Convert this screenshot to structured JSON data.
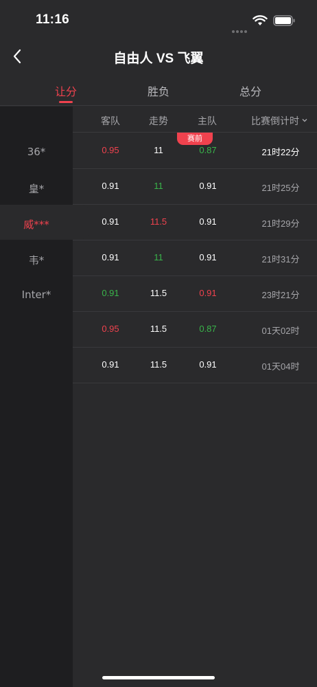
{
  "status_bar": {
    "time": "11:16"
  },
  "nav": {
    "title": "自由人 VS 飞翼"
  },
  "tabs": [
    {
      "label": "让分",
      "active": true
    },
    {
      "label": "胜负",
      "active": false
    },
    {
      "label": "总分",
      "active": false
    }
  ],
  "table": {
    "headers": {
      "away": "客队",
      "trend": "走势",
      "home": "主队",
      "countdown": "比赛倒计时"
    },
    "prematch_badge": "赛前",
    "companies": [
      {
        "name": "36*",
        "active": false
      },
      {
        "name": "皇*",
        "active": false
      },
      {
        "name": "威***",
        "active": true
      },
      {
        "name": "韦*",
        "active": false
      },
      {
        "name": "Inter*",
        "active": false
      }
    ],
    "rows": [
      {
        "away": "0.95",
        "away_color": "red",
        "trend": "11",
        "trend_color": "white",
        "home": "0.87",
        "home_color": "green",
        "countdown": "21时22分",
        "countdown_bright": true
      },
      {
        "away": "0.91",
        "away_color": "white",
        "trend": "11",
        "trend_color": "green",
        "home": "0.91",
        "home_color": "white",
        "countdown": "21时25分",
        "countdown_bright": false
      },
      {
        "away": "0.91",
        "away_color": "white",
        "trend": "11.5",
        "trend_color": "red",
        "home": "0.91",
        "home_color": "white",
        "countdown": "21时29分",
        "countdown_bright": false
      },
      {
        "away": "0.91",
        "away_color": "white",
        "trend": "11",
        "trend_color": "green",
        "home": "0.91",
        "home_color": "white",
        "countdown": "21时31分",
        "countdown_bright": false
      },
      {
        "away": "0.91",
        "away_color": "green",
        "trend": "11.5",
        "trend_color": "white",
        "home": "0.91",
        "home_color": "red",
        "countdown": "23时21分",
        "countdown_bright": false
      },
      {
        "away": "0.95",
        "away_color": "red",
        "trend": "11.5",
        "trend_color": "white",
        "home": "0.87",
        "home_color": "green",
        "countdown": "01天02时",
        "countdown_bright": false
      },
      {
        "away": "0.91",
        "away_color": "white",
        "trend": "11.5",
        "trend_color": "white",
        "home": "0.91",
        "home_color": "white",
        "countdown": "01天04时",
        "countdown_bright": false
      }
    ]
  },
  "colors": {
    "accent_red": "#f0424e",
    "up_green": "#39b54a",
    "background": "#2a2a2c",
    "sidebar": "#1e1e20"
  },
  "icons": {
    "back": "chevron-left-icon",
    "sort": "chevron-down-icon",
    "wifi": "wifi-icon",
    "battery": "battery-icon"
  }
}
